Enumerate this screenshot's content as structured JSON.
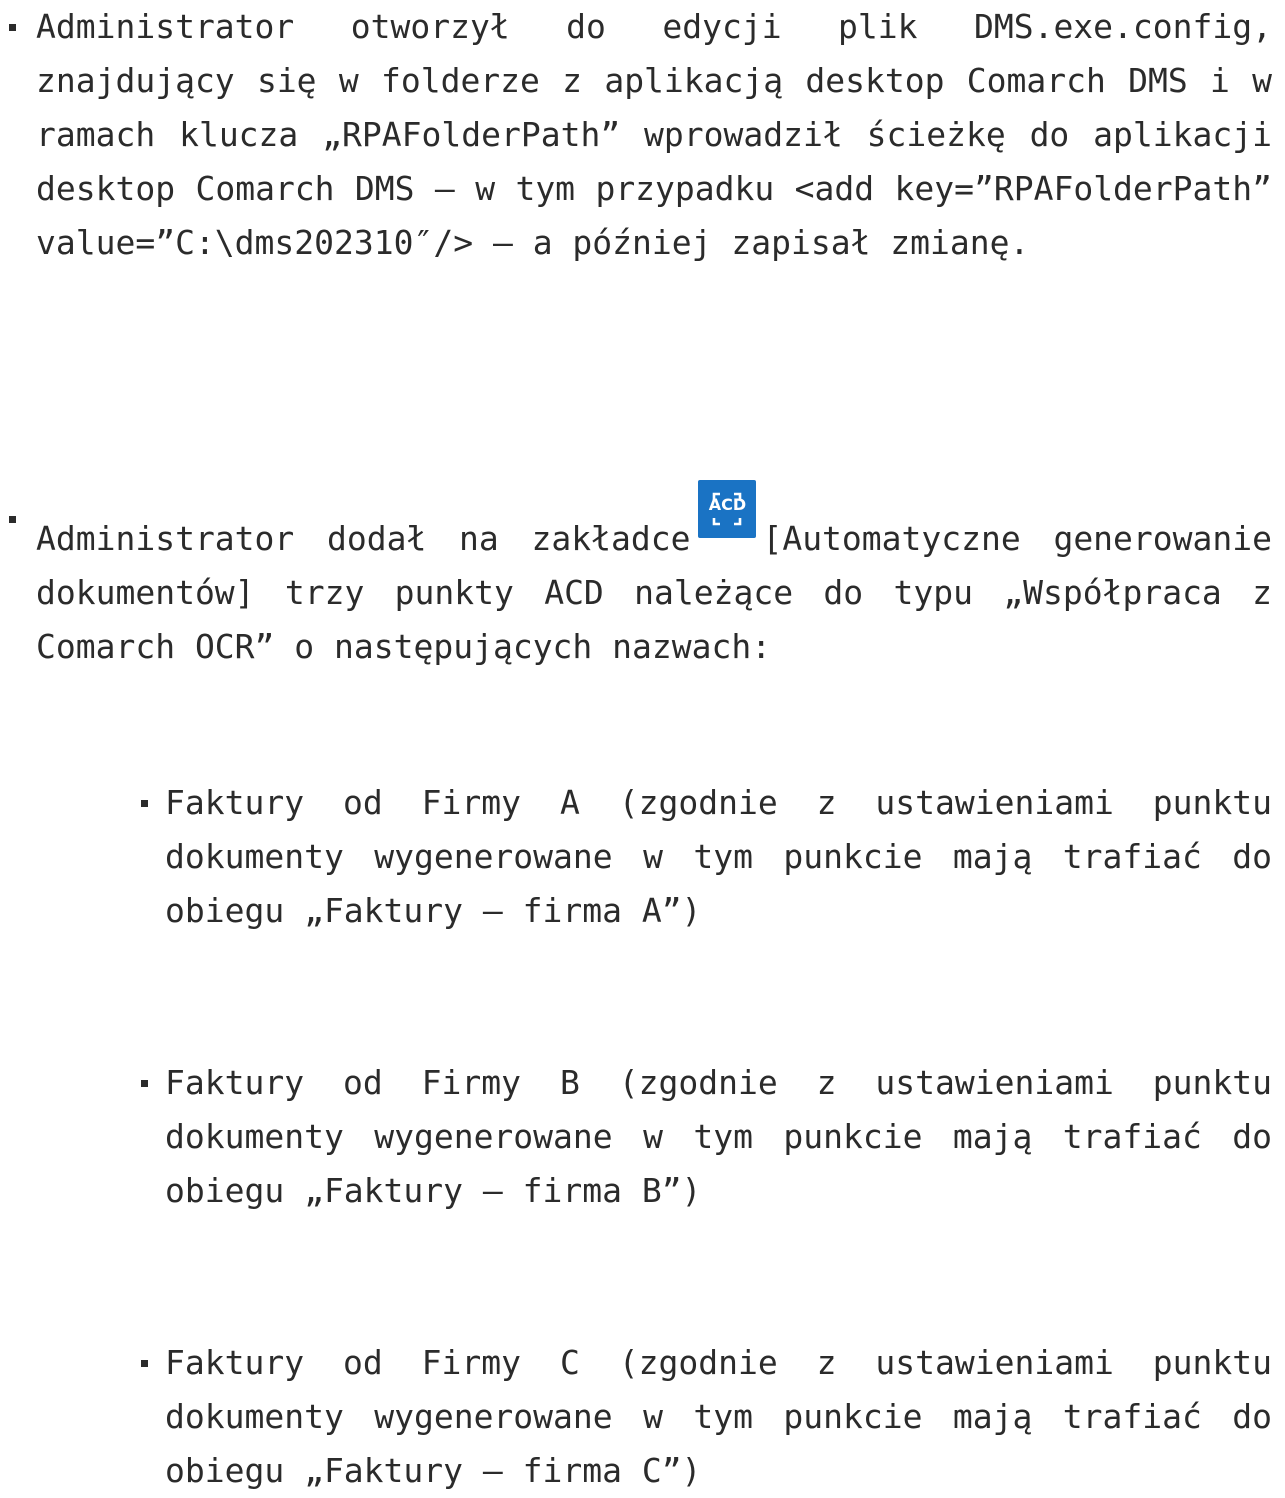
{
  "colors": {
    "text": "#2b2b2b",
    "icon_bg": "#1a73c4",
    "icon_fg": "#ffffff"
  },
  "items": [
    {
      "text": "Administrator otworzył do edycji plik DMS.exe.config, znajdujący się w folderze z aplikacją desktop Comarch DMS i w ramach klucza „RPAFolderPath” wprowadził ścieżkę do aplikacji desktop Comarch DMS – w tym przypadku <add key=”RPAFolderPath” value=”C:\\dms202310″/> – a później zapisał zmianę."
    },
    {
      "text_before_icon": "Administrator dodał na zakładce",
      "icon": "acd-icon",
      "icon_label": "ACD",
      "text_after_icon": "[Automatyczne generowanie dokumentów] trzy punkty ACD należące do typu „Współpraca z Comarch OCR” o następujących nazwach:"
    }
  ],
  "subitems": [
    {
      "text": "Faktury od Firmy A (zgodnie z ustawieniami punktu dokumenty wygenerowane w tym punkcie mają trafiać do obiegu „Faktury – firma A”)"
    },
    {
      "text": "Faktury od Firmy B (zgodnie z ustawieniami punktu dokumenty wygenerowane w tym punkcie mają trafiać do obiegu „Faktury – firma B”)"
    },
    {
      "text": "Faktury od Firmy C (zgodnie z ustawieniami punktu dokumenty wygenerowane w tym punkcie mają trafiać do obiegu „Faktury – firma C”)"
    }
  ]
}
